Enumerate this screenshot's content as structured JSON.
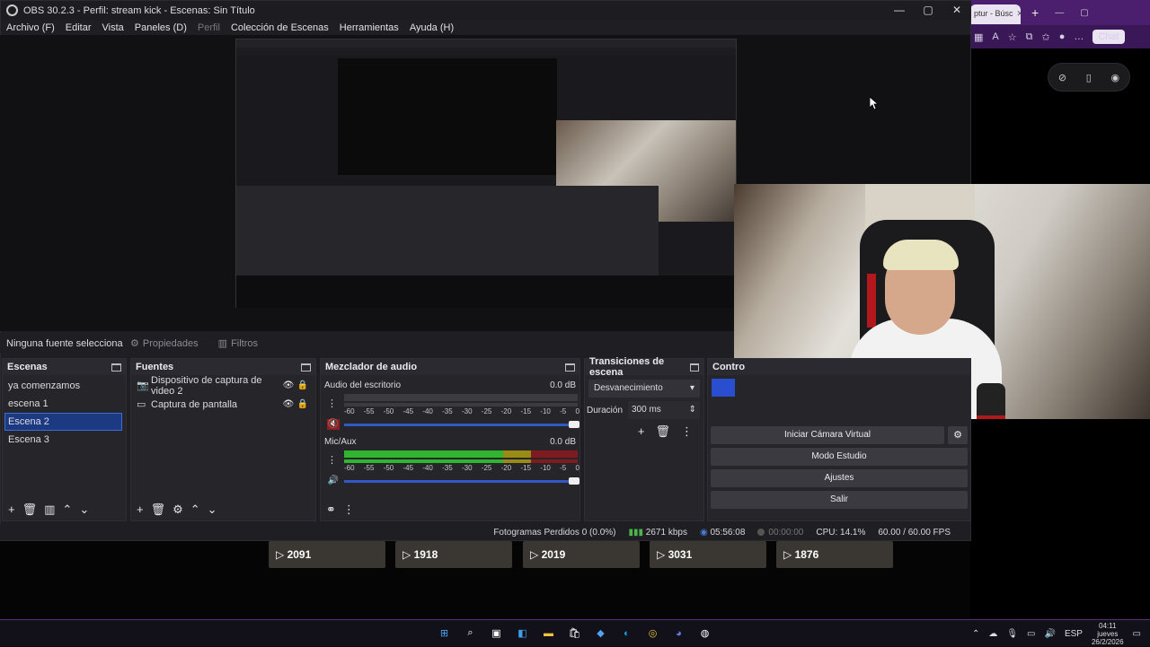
{
  "browser": {
    "tab_title": "ptur - Búsc",
    "new_tab": "+",
    "toolbar_icons": [
      "tab-groups-icon",
      "translate-icon",
      "favorite-icon",
      "extensions-icon",
      "favorites-bar-icon",
      "profile-icon",
      "more-icon"
    ],
    "chat_label": "Chat"
  },
  "obs": {
    "title": "OBS 30.2.3 - Perfil: stream kick - Escenas: Sin Título",
    "menu": [
      "Archivo (F)",
      "Editar",
      "Vista",
      "Paneles (D)",
      "Perfil",
      "Colección de Escenas",
      "Herramientas",
      "Ayuda (H)"
    ],
    "source_bar": {
      "no_source": "Ninguna fuente selecciona",
      "properties": "Propiedades",
      "filters": "Filtros"
    },
    "scenes": {
      "title": "Escenas",
      "items": [
        "ya comenzamos",
        "escena 1",
        "Escena 2",
        "Escena 3"
      ],
      "selected_index": 2
    },
    "sources": {
      "title": "Fuentes",
      "items": [
        {
          "name": "Dispositivo de captura de video 2",
          "icon": "camera-icon"
        },
        {
          "name": "Captura de pantalla",
          "icon": "monitor-icon"
        }
      ]
    },
    "mixer": {
      "title": "Mezclador de audio",
      "ticks": [
        "-60",
        "-55",
        "-50",
        "-45",
        "-40",
        "-35",
        "-30",
        "-25",
        "-20",
        "-15",
        "-10",
        "-5",
        "0"
      ],
      "channels": [
        {
          "name": "Audio del escritorio",
          "db": "0.0 dB",
          "level": 0.0,
          "muted": true
        },
        {
          "name": "Mic/Aux",
          "db": "0.0 dB",
          "level": 0.72,
          "muted": false
        }
      ]
    },
    "transitions": {
      "title": "Transiciones de escena",
      "selected": "Desvanecimiento",
      "duration_label": "Duración",
      "duration_value": "300 ms"
    },
    "controls": {
      "title": "Contro",
      "virtual_cam": "Iniciar Cámara Virtual",
      "studio_mode": "Modo Estudio",
      "settings": "Ajustes",
      "exit": "Salir"
    },
    "status": {
      "dropped": "Fotogramas Perdidos 0 (0.0%)",
      "bitrate": "2671 kbps",
      "stream_time": "05:56:08",
      "rec_time": "00:00:00",
      "cpu": "CPU: 14.1%",
      "fps": "60.00 / 60.00 FPS"
    }
  },
  "video_strip": {
    "thumbs": [
      "2091",
      "1918",
      "2019",
      "3031",
      "1876"
    ]
  },
  "taskbar": {
    "apps": [
      "windows-start-icon",
      "search-icon",
      "task-view-icon",
      "widgets-icon",
      "file-explorer-icon",
      "store-icon",
      "vpn-icon",
      "edge-icon",
      "chrome-icon",
      "discord-icon",
      "obs-icon"
    ],
    "lang": "ESP",
    "time": "04:11",
    "day": "jueves",
    "date": "26/2/2026"
  },
  "colors": {
    "accent": "#3f6bd6",
    "browser_frame": "#4b1f6e",
    "meter_green": "#2fb52f",
    "meter_yellow": "#c8b81c",
    "meter_red": "#c8252d"
  }
}
